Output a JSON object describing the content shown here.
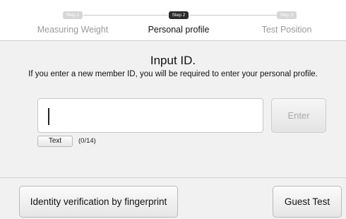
{
  "steps": [
    {
      "badge": "Step 1",
      "label": "Measuring Weight",
      "state": "inactive"
    },
    {
      "badge": "Step 2",
      "label": "Personal profile",
      "state": "active"
    },
    {
      "badge": "Step 3",
      "label": "Test Position",
      "state": "inactive"
    }
  ],
  "main": {
    "title": "Input ID.",
    "instruction": "If you enter a new member ID, you will be required to enter your personal profile.",
    "id_input_value": "",
    "enter_label": "Enter",
    "text_button_label": "Text",
    "char_counter": "(0/14)"
  },
  "footer": {
    "fingerprint_label": "Identity verification by fingerprint",
    "guest_label": "Guest Test"
  },
  "colors": {
    "background": "#f1f1f1",
    "active_step_badge": "#2b2b2b",
    "inactive_step": "#9a9a9a"
  }
}
